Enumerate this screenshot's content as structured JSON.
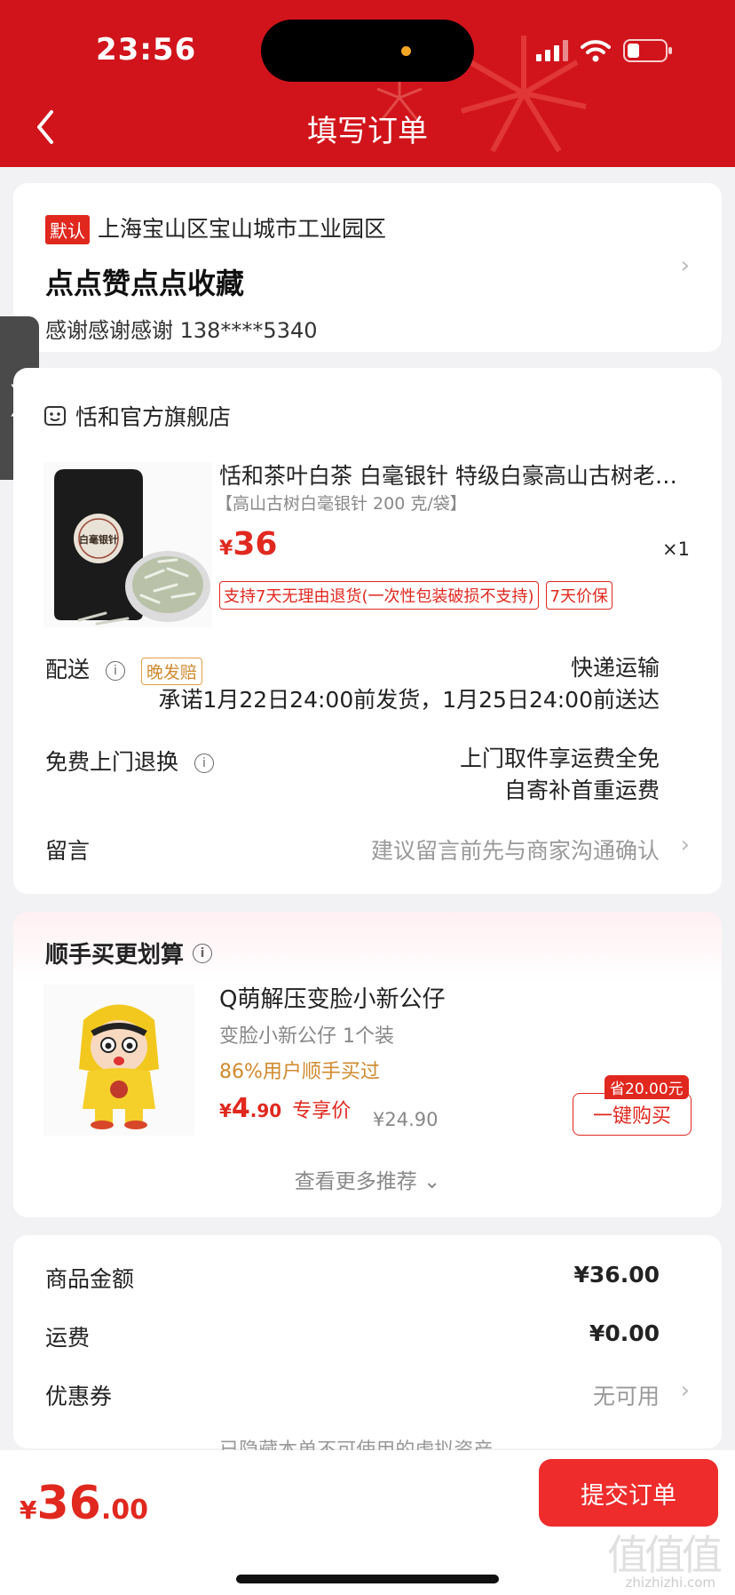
{
  "status": {
    "time": "23:56"
  },
  "nav": {
    "title": "填写订单",
    "back_icon": "chevron-left-icon"
  },
  "address": {
    "badge": "默认",
    "line": "上海宝山区宝山城市工业园区",
    "name": "点点赞点点收藏",
    "contact": "感谢感谢感谢  138****5340"
  },
  "side_tab": {
    "glyph": "❯"
  },
  "store": {
    "name": "恬和官方旗舰店",
    "product": {
      "title": "恬和茶叶白茶 白毫银针 特级白豪高山古树老…",
      "spec": "【高山古树白毫银针 200 克/袋】",
      "currency": "¥",
      "price": "36",
      "qty": "×1",
      "package_label": "白毫银针",
      "tags": [
        "支持7天无理由退货(一次性包装破损不支持)",
        "7天价保"
      ]
    },
    "delivery": {
      "label": "配送",
      "badge": "晚发赔",
      "method": "快递运输",
      "promise": "承诺1月22日24:00前发货，1月25日24:00前送达"
    },
    "returns": {
      "label": "免费上门退换",
      "line1": "上门取件享运费全免",
      "line2": "自寄补首重运费"
    },
    "message": {
      "label": "留言",
      "placeholder": "建议留言前先与商家沟通确认"
    }
  },
  "upsell": {
    "title": "顺手买更划算",
    "name": "Q萌解压变脸小新公仔",
    "sub": "变脸小新公仔 1个装",
    "bought": "86%用户顺手买过",
    "currency": "¥",
    "price_int": "4",
    "price_dec": ".90",
    "price_label": "专享价",
    "old_price": "¥24.90",
    "save_badge": "省20.00元",
    "buy_label": "一键购买",
    "more": "查看更多推荐 ⌄"
  },
  "summary": {
    "goods_label": "商品金额",
    "goods_value": "¥36.00",
    "shipping_label": "运费",
    "shipping_value": "¥0.00",
    "coupon_label": "优惠券",
    "coupon_value": "无可用",
    "hidden_note": "已隐藏本单不可使用的虚拟资产 ⌄"
  },
  "bottom": {
    "currency": "¥",
    "total_int": "36",
    "total_dec": ".00",
    "submit": "提交订单",
    "watermark": "值值值",
    "watermark_sub": "zhizhizhi.com"
  },
  "colors": {
    "accent": "#d1141b",
    "price": "#e0281f"
  }
}
